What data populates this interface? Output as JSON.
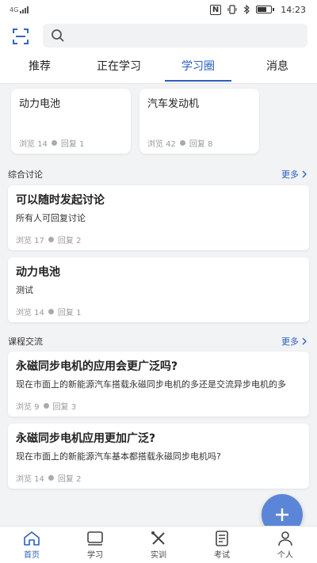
{
  "status_bar": {
    "carrier": "4G",
    "time": "14:23",
    "battery_level": 0.7
  },
  "search": {
    "placeholder": ""
  },
  "tabs": [
    {
      "label": "推荐"
    },
    {
      "label": "正在学习"
    },
    {
      "label": "学习圈",
      "active": true
    },
    {
      "label": "消息"
    }
  ],
  "top_cards": [
    {
      "title": "动力电池",
      "views": "浏览 14",
      "replies": "回复 1"
    },
    {
      "title": "汽车发动机",
      "views": "浏览 42",
      "replies": "回复 8"
    }
  ],
  "sections": {
    "general": {
      "title": "综合讨论",
      "more": "更多"
    },
    "course": {
      "title": "课程交流",
      "more": "更多"
    }
  },
  "general_posts": [
    {
      "title": "可以随时发起讨论",
      "desc": "所有人可回复讨论",
      "views": "浏览 17",
      "replies": "回复 2"
    },
    {
      "title": "动力电池",
      "desc": "测试",
      "views": "浏览 14",
      "replies": "回复 1"
    }
  ],
  "course_posts": [
    {
      "title": "永磁同步电机的应用会更广泛吗?",
      "desc": "现在市面上的新能源汽车搭载永磁同步电机的多还是交流异步电机的多",
      "views": "浏览 9",
      "replies": "回复 3"
    },
    {
      "title": "永磁同步电机应用更加广泛?",
      "desc": "现在市面上的新能源汽车基本都搭载永磁同步电机吗?",
      "views": "浏览 14",
      "replies": "回复 2"
    }
  ],
  "bottom_nav": [
    {
      "label": "首页",
      "icon": "home-icon",
      "active": true
    },
    {
      "label": "学习",
      "icon": "book-icon"
    },
    {
      "label": "实训",
      "icon": "tools-icon"
    },
    {
      "label": "考试",
      "icon": "exam-icon"
    },
    {
      "label": "个人",
      "icon": "person-icon"
    }
  ],
  "colors": {
    "accent": "#2b5fbf",
    "fab": "#5b86d8",
    "background": "#f2f3f5"
  }
}
